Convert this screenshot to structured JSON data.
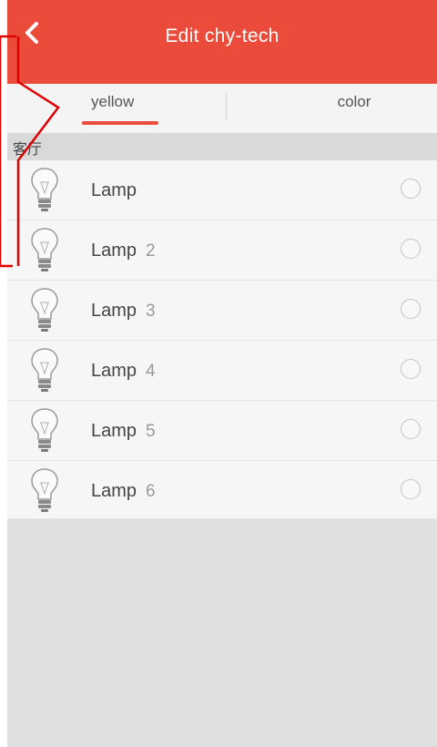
{
  "header": {
    "title": "Edit chy-tech",
    "back_icon": "chevron-left-icon",
    "bg_color": "#ea4b3b"
  },
  "tabs": [
    {
      "label": "yellow",
      "active": true
    },
    {
      "label": "color",
      "active": false
    }
  ],
  "group": {
    "label": "客厅"
  },
  "lamps": [
    {
      "name": "Lamp",
      "number": "",
      "selected": false,
      "icon": "lightbulb-icon"
    },
    {
      "name": "Lamp",
      "number": "2",
      "selected": false,
      "icon": "lightbulb-icon"
    },
    {
      "name": "Lamp",
      "number": "3",
      "selected": false,
      "icon": "lightbulb-icon"
    },
    {
      "name": "Lamp",
      "number": "4",
      "selected": false,
      "icon": "lightbulb-icon"
    },
    {
      "name": "Lamp",
      "number": "5",
      "selected": false,
      "icon": "lightbulb-icon"
    },
    {
      "name": "Lamp",
      "number": "6",
      "selected": false,
      "icon": "lightbulb-icon"
    }
  ],
  "colors": {
    "accent": "#ea4b3b",
    "callout": "#e00000"
  }
}
